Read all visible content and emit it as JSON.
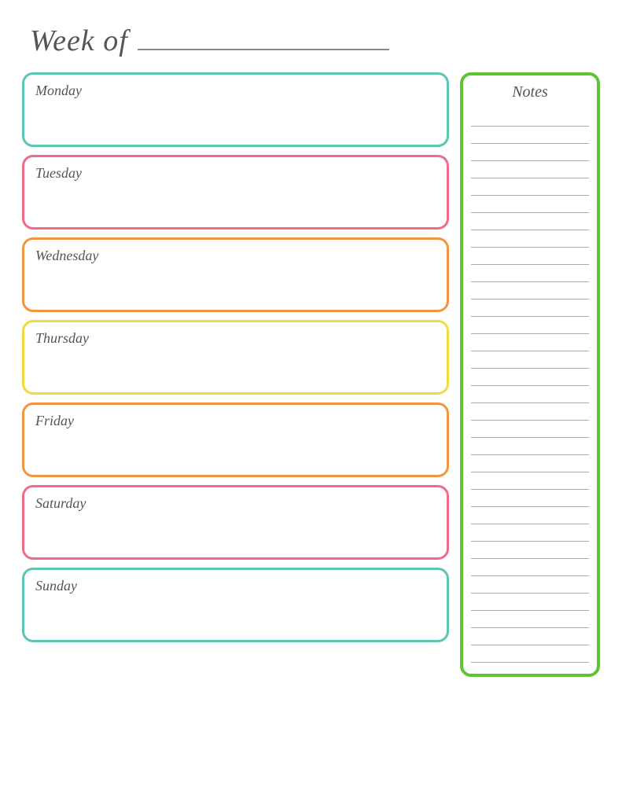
{
  "header": {
    "week_of_label": "Week of",
    "line_placeholder": ""
  },
  "days": [
    {
      "id": "monday",
      "label": "Monday",
      "css_class": "monday"
    },
    {
      "id": "tuesday",
      "label": "Tuesday",
      "css_class": "tuesday"
    },
    {
      "id": "wednesday",
      "label": "Wednesday",
      "css_class": "wednesday"
    },
    {
      "id": "thursday",
      "label": "Thursday",
      "css_class": "thursday"
    },
    {
      "id": "friday",
      "label": "Friday",
      "css_class": "friday"
    },
    {
      "id": "saturday",
      "label": "Saturday",
      "css_class": "saturday"
    },
    {
      "id": "sunday",
      "label": "Sunday",
      "css_class": "sunday"
    }
  ],
  "notes": {
    "title": "Notes",
    "line_count": 32
  },
  "colors": {
    "monday_border": "#5dc5b0",
    "tuesday_border": "#f06b8a",
    "wednesday_border": "#f09640",
    "thursday_border": "#f0db40",
    "friday_border": "#f09640",
    "saturday_border": "#f06b8a",
    "sunday_border": "#5dc5b0",
    "notes_border": "#5dc530"
  }
}
